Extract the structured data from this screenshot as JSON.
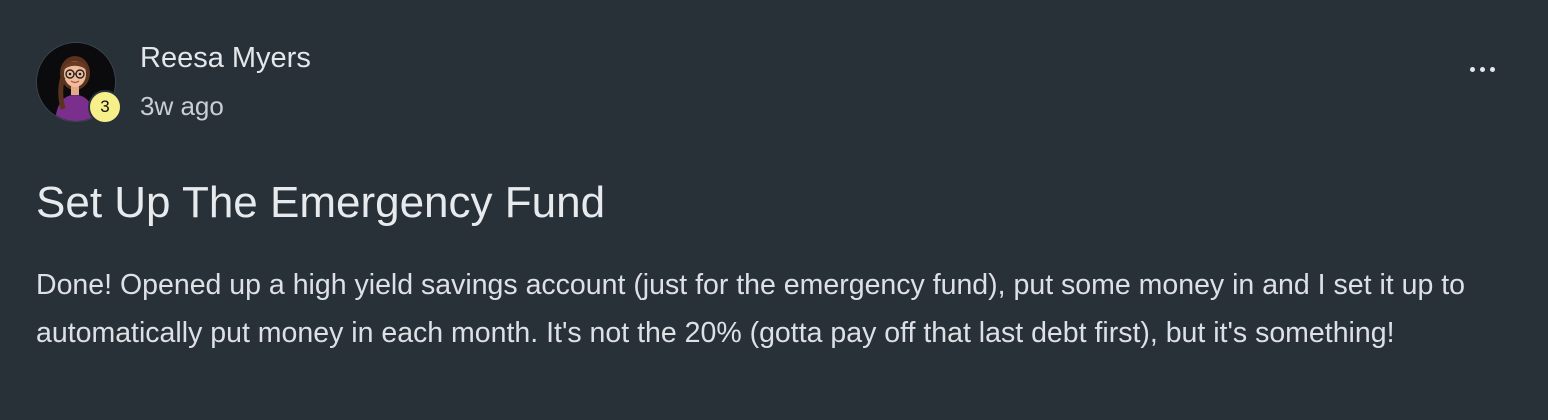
{
  "post": {
    "author": "Reesa Myers",
    "timestamp": "3w ago",
    "level": "3",
    "title": "Set Up The Emergency Fund",
    "body": "Done! Opened up a high yield savings account (just for the emergency fund), put some money in and I set it up to automatically put money in each month. It's not the 20% (gotta pay off that last debt first), but it's something!",
    "avatar_icon": "avatar-illustration",
    "menu_icon": "more-horizontal-icon"
  },
  "colors": {
    "background": "#283138",
    "badge": "#f7ef8a",
    "text": "#e6e9ec"
  }
}
